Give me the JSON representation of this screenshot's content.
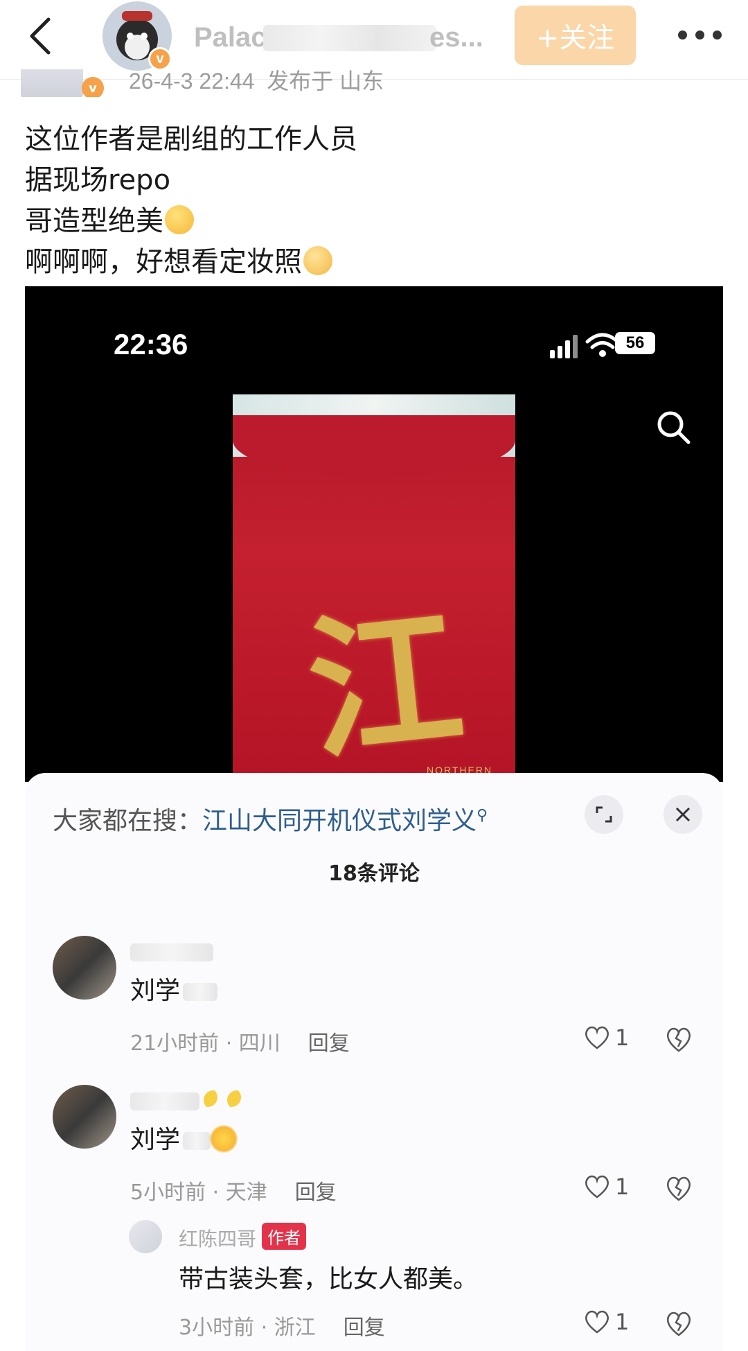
{
  "header": {
    "username": "Palac",
    "username_tail": "es...",
    "follow_label": "+关注"
  },
  "meta": {
    "timestamp": "26-4-3 22:44",
    "location": "发布于 山东"
  },
  "post": {
    "lines": [
      "这位作者是剧组的工作人员",
      "据现场repo",
      "哥造型绝美",
      "啊啊啊，好想看定妆照"
    ]
  },
  "media": {
    "clock": "22:36",
    "battery": "56",
    "watermark_text": "江山",
    "watermark_sub": "NORTHERN"
  },
  "comments_panel": {
    "hot_search_label": "大家都在搜：",
    "hot_search_link": "江山大同开机仪式刘学义",
    "comment_count": "18条评论",
    "comments": [
      {
        "body": "刘学",
        "time": "21小时前 · 四川",
        "reply": "回复",
        "likes": "1"
      },
      {
        "body": "刘学",
        "time": "5小时前 · 天津",
        "reply": "回复",
        "likes": "1"
      },
      {
        "name": "红陈四哥",
        "badge": "作者",
        "body": "带古装头套，比女人都美。",
        "time": "3小时前 · 浙江",
        "reply": "回复",
        "likes": "1"
      }
    ]
  }
}
